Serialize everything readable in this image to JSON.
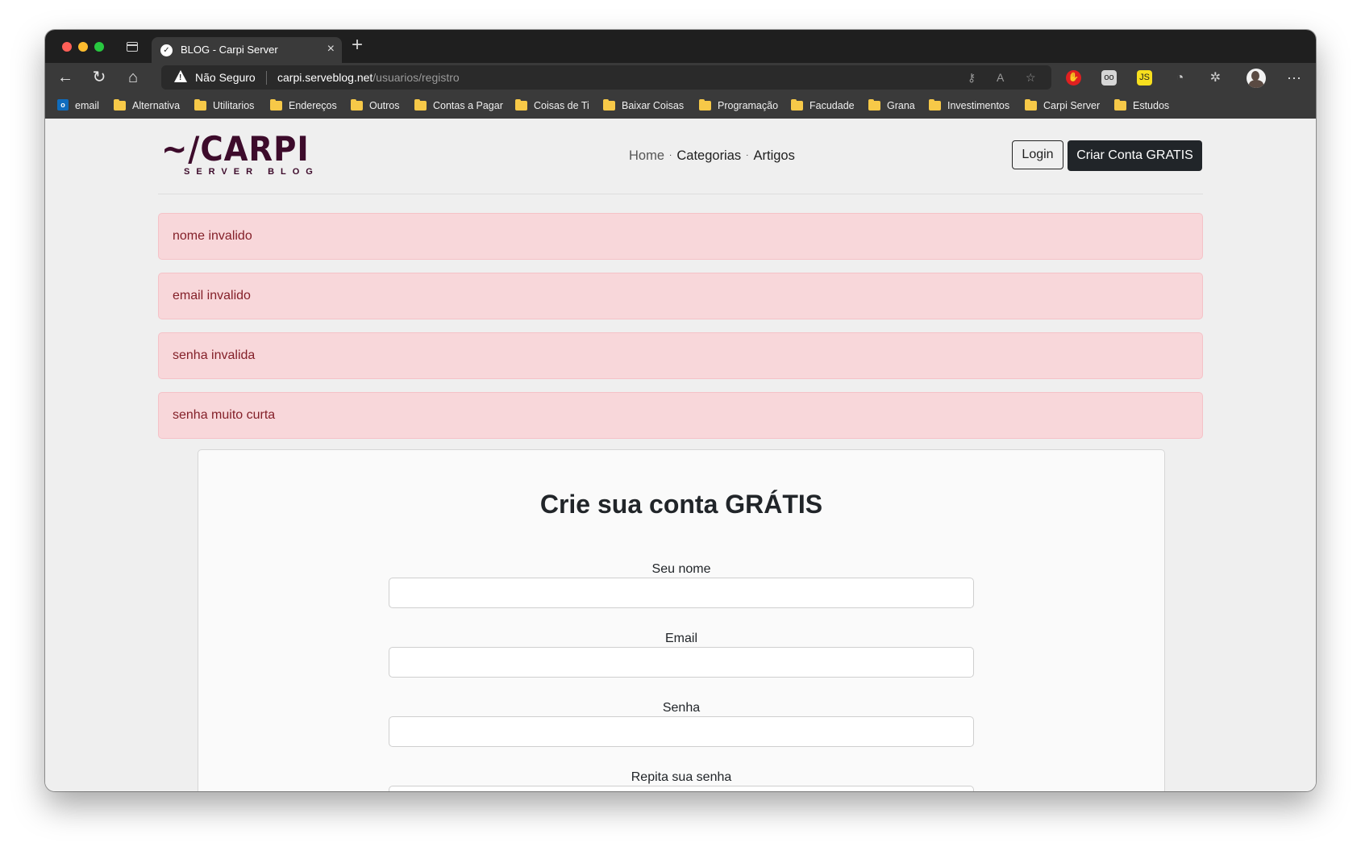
{
  "browser": {
    "tab_title": "BLOG - Carpi Server",
    "tab_favicon": "✓",
    "new_tab_label": "+",
    "close_label": "×",
    "security_label": "Não Seguro",
    "url_host": "carpi.serveblog.net",
    "url_path": "/usuarios/registro",
    "ext_js_label": "JS",
    "ext_oo_label": "oo",
    "more_label": "···"
  },
  "bookmarks": [
    {
      "label": "email",
      "icon": "outlook-icon",
      "icon_label": "o"
    },
    {
      "label": "Alternativa",
      "icon": "folder-icon"
    },
    {
      "label": "Utilitarios",
      "icon": "folder-icon"
    },
    {
      "label": "Endereços",
      "icon": "folder-icon"
    },
    {
      "label": "Outros",
      "icon": "folder-icon"
    },
    {
      "label": "Contas a Pagar",
      "icon": "folder-icon"
    },
    {
      "label": "Coisas de Ti",
      "icon": "folder-icon"
    },
    {
      "label": "Baixar Coisas",
      "icon": "folder-icon"
    },
    {
      "label": "Programação",
      "icon": "folder-icon"
    },
    {
      "label": "Facudade",
      "icon": "folder-icon"
    },
    {
      "label": "Grana",
      "icon": "folder-icon"
    },
    {
      "label": "Investimentos",
      "icon": "folder-icon"
    },
    {
      "label": "Carpi Server",
      "icon": "folder-icon"
    },
    {
      "label": "Estudos",
      "icon": "folder-icon"
    }
  ],
  "site": {
    "logo_main": "~/CARPI",
    "logo_sub": "SERVER BLOG",
    "nav": {
      "home": "Home",
      "categorias": "Categorias",
      "artigos": "Artigos",
      "separator": "·"
    },
    "login_label": "Login",
    "signup_label": "Criar Conta GRATIS"
  },
  "alerts": [
    "nome invalido",
    "email invalido",
    "senha invalida",
    "senha muito curta"
  ],
  "form": {
    "title": "Crie sua conta GRÁTIS",
    "name_label": "Seu nome",
    "email_label": "Email",
    "password_label": "Senha",
    "repeat_password_label": "Repita sua senha",
    "name_value": "",
    "email_value": "",
    "password_value": "",
    "repeat_password_value": ""
  },
  "colors": {
    "alert_bg": "#f8d7da",
    "alert_text": "#842029",
    "brand": "#3d0b2b",
    "primary_button": "#212529"
  }
}
